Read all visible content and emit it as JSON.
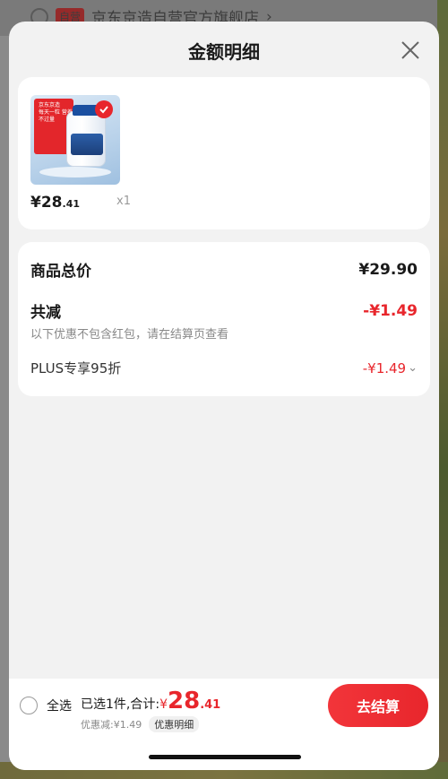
{
  "background": {
    "shop_tag": "自营",
    "shop_name": "京东京造自营官方旗舰店",
    "shop_chevron": "›"
  },
  "sheet": {
    "title": "金额明细",
    "close_icon": "close-icon"
  },
  "product": {
    "thumb_brand": "京东京造",
    "thumb_lines": "每天一粒 营养不过量",
    "price_symbol": "¥",
    "price_int": "28",
    "price_dec": ".41",
    "qty": "x1"
  },
  "summary": {
    "total_label": "商品总价",
    "total_value": "¥29.90",
    "reduce_label": "共减",
    "reduce_value": "-¥1.49",
    "note": "以下优惠不包含红包，请在结算页查看",
    "plus_label": "PLUS专享95折",
    "plus_value": "-¥1.49",
    "plus_chevron": "⌄"
  },
  "bottom_bar": {
    "select_all_label": "全选",
    "selected_text": "已选1件,合计:",
    "total_currency": "¥",
    "total_int": "28",
    "total_dec": ".41",
    "discount_text": "优惠减:¥1.49",
    "detail_chip": "优惠明细",
    "checkout_label": "去结算"
  },
  "colors": {
    "accent_red": "#e8262c",
    "sheet_bg": "#f2f2f2"
  }
}
